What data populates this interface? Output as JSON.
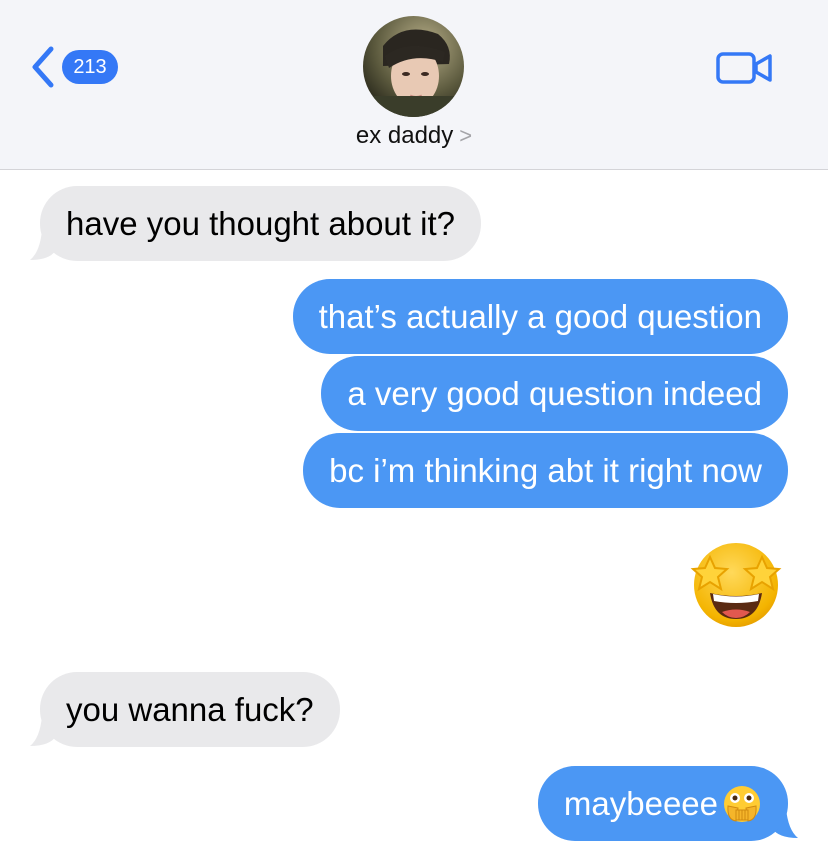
{
  "header": {
    "back_count": "213",
    "contact_name": "ex daddy",
    "chevron": ">",
    "icons": [
      "back-chevron-icon",
      "video-camera-icon",
      "contact-avatar-photo"
    ]
  },
  "messages": [
    {
      "from": "them",
      "text": "have you thought about it?"
    },
    {
      "from": "me",
      "text": "that’s actually a good question"
    },
    {
      "from": "me",
      "text": "a very good question indeed"
    },
    {
      "from": "me",
      "text": "bc i’m thinking abt it right now"
    },
    {
      "from": "me",
      "emoji": "star-struck-emoji"
    },
    {
      "from": "them",
      "text": "you wanna fuck?"
    },
    {
      "from": "me",
      "text": "maybeeee",
      "emoji": "face-with-open-eyes-and-hand-over-mouth"
    }
  ],
  "colors": {
    "sent_bubble": "#4b97f4",
    "received_bubble": "#e9e9eb",
    "accent": "#3478f6"
  }
}
